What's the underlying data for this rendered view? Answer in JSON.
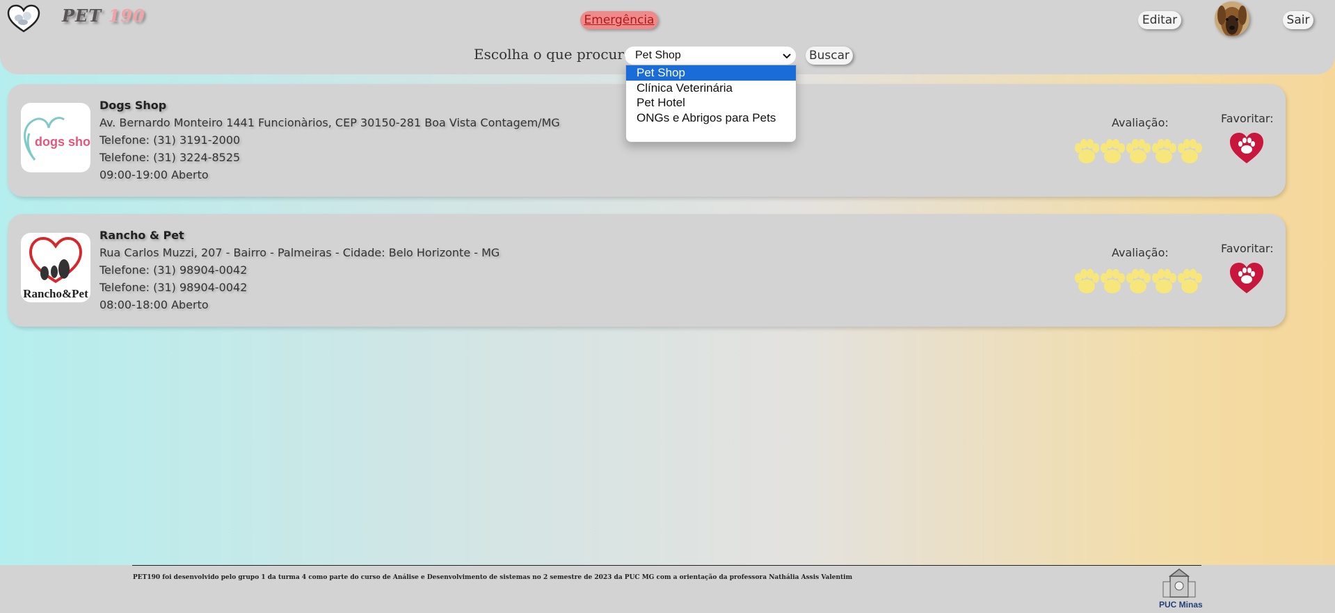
{
  "header": {
    "brand_part1": "PET",
    "brand_part2": "190",
    "emergency_label": "Emergência",
    "edit_label": "Editar",
    "logout_label": "Sair"
  },
  "search": {
    "label": "Escolha o que procura:",
    "selected": "Pet Shop",
    "button_label": "Buscar",
    "options": [
      "Pet Shop",
      "Clínica Veterinária",
      "Pet Hotel",
      "ONGs e Abrigos para Pets"
    ]
  },
  "results": [
    {
      "name": "Dogs Shop",
      "logo_text": "dogs shop",
      "address": "Av. Bernardo Monteiro 1441 Funcionàrios, CEP 30150-281 Boa Vista Contagem/MG",
      "phone1": "Telefone: (31) 3191-2000",
      "phone2": "Telefone: (31) 3224-8525",
      "hours": "09:00-19:00 Aberto",
      "rating_label": "Avaliação:",
      "rating": 5,
      "favorite_label": "Favoritar:"
    },
    {
      "name": "Rancho & Pet",
      "logo_text": "Rancho&Pet",
      "address": "Rua Carlos Muzzi, 207 - Bairro - Palmeiras - Cidade: Belo Horizonte - MG",
      "phone1": "Telefone: (31) 98904-0042",
      "phone2": "Telefone: (31) 98904-0042",
      "hours": "08:00-18:00 Aberto",
      "rating_label": "Avaliação:",
      "rating": 5,
      "favorite_label": "Favoritar:"
    }
  ],
  "footer": {
    "credit": "PET190 foi desenvolvido pelo grupo 1 da turma 4 como parte do curso de Análise e Desenvolvimento de sistemas no 2 semestre de 2023 da PUC MG com a orientação da professora Nathália Assis Valentim",
    "university": "PUC Minas"
  },
  "colors": {
    "emergency": "#ef8a8a",
    "favorite_heart": "#c8163c",
    "paw": "#f7e77a",
    "dropdown_selected": "#1a6dd9"
  },
  "icons": {
    "logo": "heart-pets-logo-icon",
    "select_chevron": "chevron-down-icon",
    "rating": "paw-icon",
    "favorite": "heart-paw-icon"
  }
}
